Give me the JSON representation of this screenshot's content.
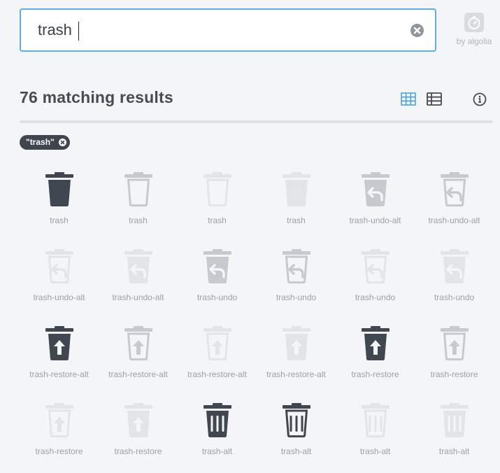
{
  "search": {
    "value": "trash",
    "clear_icon": "times-circle-icon"
  },
  "algolia": {
    "label": "by algolia",
    "icon": "stopwatch-icon"
  },
  "results": {
    "title": "76 matching results"
  },
  "view_controls": {
    "grid_icon": "th-icon",
    "list_icon": "th-list-icon",
    "info_icon": "info-circle-icon"
  },
  "filter": {
    "label": "\"trash\""
  },
  "colors": {
    "accent": "#4aa3df",
    "icon_dark": "#404750",
    "icon_mid": "#c6cacf",
    "icon_light": "#e2e5e8"
  },
  "icons": [
    {
      "label": "trash",
      "shape": "trash",
      "style": "solid",
      "tone": "dark"
    },
    {
      "label": "trash",
      "shape": "trash",
      "style": "outline",
      "tone": "mid"
    },
    {
      "label": "trash",
      "shape": "trash",
      "style": "outline",
      "tone": "light"
    },
    {
      "label": "trash",
      "shape": "trash",
      "style": "solid",
      "tone": "light"
    },
    {
      "label": "trash-undo-alt",
      "shape": "undo-alt",
      "style": "solid",
      "tone": "mid"
    },
    {
      "label": "trash-undo-alt",
      "shape": "undo-alt",
      "style": "outline",
      "tone": "mid"
    },
    {
      "label": "trash-undo-alt",
      "shape": "undo-alt",
      "style": "outline",
      "tone": "light"
    },
    {
      "label": "trash-undo-alt",
      "shape": "undo-alt",
      "style": "solid",
      "tone": "light"
    },
    {
      "label": "trash-undo",
      "shape": "undo",
      "style": "solid",
      "tone": "mid"
    },
    {
      "label": "trash-undo",
      "shape": "undo",
      "style": "outline",
      "tone": "mid"
    },
    {
      "label": "trash-undo",
      "shape": "undo",
      "style": "outline",
      "tone": "light"
    },
    {
      "label": "trash-undo",
      "shape": "undo",
      "style": "solid",
      "tone": "light"
    },
    {
      "label": "trash-restore-alt",
      "shape": "restore-alt",
      "style": "solid",
      "tone": "dark"
    },
    {
      "label": "trash-restore-alt",
      "shape": "restore-alt",
      "style": "outline",
      "tone": "mid"
    },
    {
      "label": "trash-restore-alt",
      "shape": "restore-alt",
      "style": "outline",
      "tone": "light"
    },
    {
      "label": "trash-restore-alt",
      "shape": "restore-alt",
      "style": "solid",
      "tone": "light"
    },
    {
      "label": "trash-restore",
      "shape": "restore",
      "style": "solid",
      "tone": "dark"
    },
    {
      "label": "trash-restore",
      "shape": "restore",
      "style": "outline",
      "tone": "mid"
    },
    {
      "label": "trash-restore",
      "shape": "restore",
      "style": "outline",
      "tone": "light"
    },
    {
      "label": "trash-restore",
      "shape": "restore",
      "style": "solid",
      "tone": "light"
    },
    {
      "label": "trash-alt",
      "shape": "alt",
      "style": "solid",
      "tone": "dark"
    },
    {
      "label": "trash-alt",
      "shape": "alt",
      "style": "outline",
      "tone": "dark"
    },
    {
      "label": "trash-alt",
      "shape": "alt",
      "style": "outline",
      "tone": "light"
    },
    {
      "label": "trash-alt",
      "shape": "alt",
      "style": "solid",
      "tone": "light"
    }
  ]
}
